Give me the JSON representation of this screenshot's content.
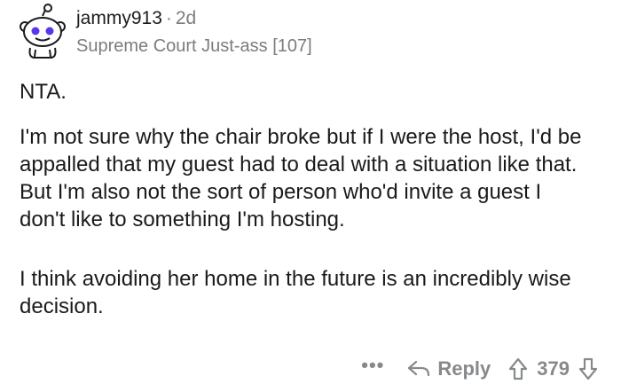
{
  "comment": {
    "username": "jammy913",
    "separator": "·",
    "age": "2d",
    "flair": "Supreme Court Just-ass [107]",
    "paragraphs": [
      "NTA.",
      "I'm not sure why the chair broke but if I were the host, I'd be appalled that my guest had to deal with a situation like that.  But I'm also not the sort of person who'd invite a guest I don't like to something I'm hosting.",
      "I think avoiding her home in the future is an incredibly wise decision."
    ]
  },
  "actions": {
    "more": "•••",
    "reply_label": "Reply",
    "score": "379",
    "icons": [
      "reply-arrow-icon",
      "upvote-arrow-icon",
      "downvote-arrow-icon"
    ]
  },
  "colors": {
    "text": "#1a1a1b",
    "muted": "#7c7c7c",
    "action": "#878a8c",
    "avatar_accent": "#5b36e8"
  }
}
